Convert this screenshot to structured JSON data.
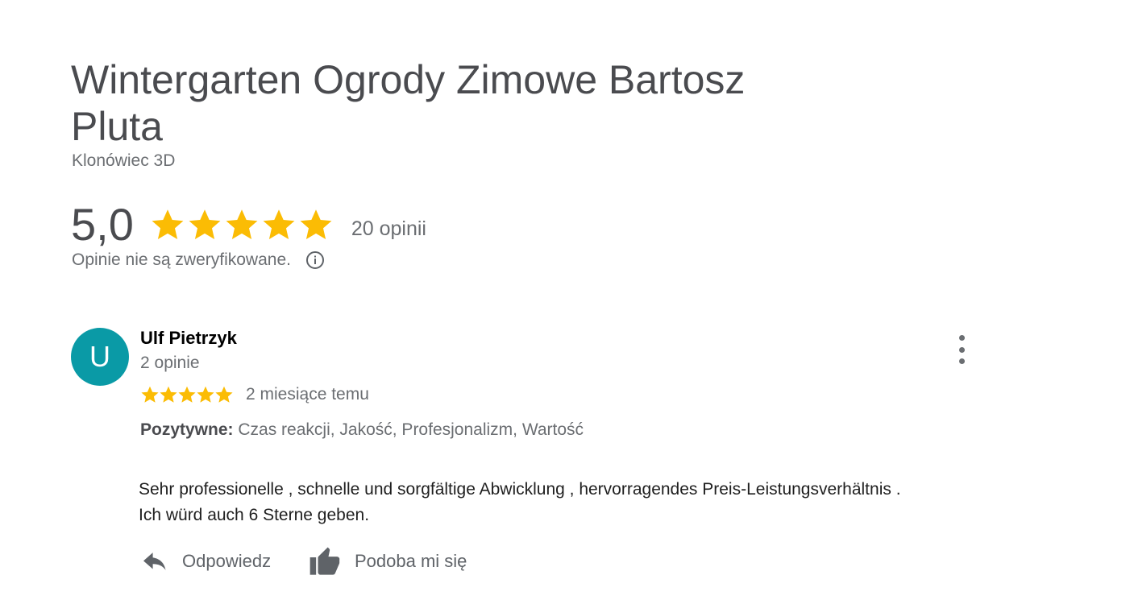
{
  "business": {
    "name": "Wintergarten Ogrody Zimowe Bartosz Pluta",
    "location": "Klonówiec 3D"
  },
  "rating": {
    "value": "5,0",
    "stars": 5,
    "review_count": "20 opinii",
    "verification_note": "Opinie nie są zweryfikowane."
  },
  "review": {
    "avatar_letter": "U",
    "avatar_color": "#0a9aa6",
    "author": "Ulf Pietrzyk",
    "author_reviews": "2 opinie",
    "stars": 5,
    "date": "2 miesiące temu",
    "attributes_label": "Pozytywne:",
    "attributes": "Czas reakcji, Jakość, Profesjonalizm, Wartość",
    "text": "Sehr professionelle , schnelle und sorgfältige Abwicklung , hervorragendes Preis-Leistungsverhältnis .\nIch würd auch 6 Sterne geben.",
    "actions": {
      "reply_label": "Odpowiedz",
      "like_label": "Podoba mi się"
    }
  },
  "colors": {
    "star": "#fbbc04",
    "text_muted": "#6b6e72",
    "title": "#4a4b4f"
  },
  "icons": {
    "info": "info-icon",
    "more": "more-vertical-icon",
    "reply": "reply-icon",
    "like": "thumbs-up-icon",
    "star": "star-icon"
  }
}
